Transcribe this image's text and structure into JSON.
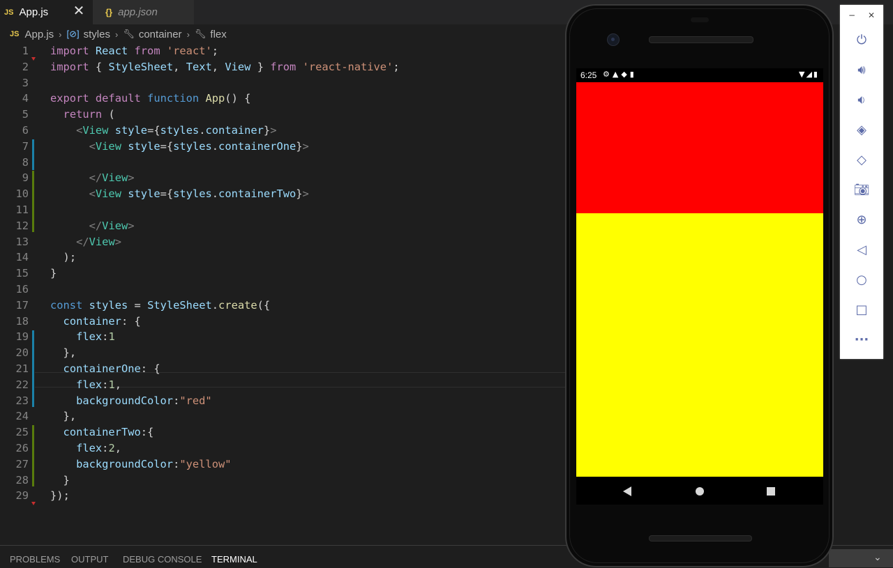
{
  "tabs": [
    {
      "badge": "JS",
      "label": "App.js",
      "close": "✕"
    },
    {
      "badge": "{}",
      "label": "app.json"
    }
  ],
  "breadcrumb": {
    "badge": "JS",
    "items": [
      "App.js",
      "styles",
      "container",
      "flex"
    ]
  },
  "code": {
    "line_numbers": [
      "1",
      "2",
      "3",
      "4",
      "5",
      "6",
      "7",
      "8",
      "9",
      "10",
      "11",
      "12",
      "13",
      "14",
      "15",
      "16",
      "17",
      "18",
      "19",
      "20",
      "21",
      "22",
      "23",
      "24",
      "25",
      "26",
      "27",
      "28",
      "29"
    ],
    "lines": [
      "import React from 'react';",
      "import { StyleSheet, Text, View } from 'react-native';",
      "",
      "export default function App() {",
      "  return (",
      "    <View style={styles.container}>",
      "      <View style={styles.containerOne}>",
      "",
      "      </View>",
      "      <View style={styles.containerTwo}>",
      "",
      "      </View>",
      "    </View>",
      "  );",
      "}",
      "",
      "const styles = StyleSheet.create({",
      "  container: {",
      "    flex:1",
      "  },",
      "  containerOne: {",
      "    flex:1,",
      "    backgroundColor:\"red\"",
      "  },",
      "  containerTwo:{",
      "    flex:2,",
      "    backgroundColor:\"yellow\"",
      "  }",
      "});"
    ]
  },
  "panel": {
    "tabs": [
      "PROBLEMS",
      "OUTPUT",
      "DEBUG CONSOLE",
      "TERMINAL"
    ],
    "active": "TERMINAL"
  },
  "phone": {
    "time": "6:25",
    "container_one_color": "#ff0000",
    "container_two_color": "#ffff00",
    "flex_ratio": [
      1,
      2
    ]
  },
  "emulator_toolbar": {
    "window_controls": [
      "−",
      "✕"
    ],
    "buttons": [
      "power-icon",
      "volume-up-icon",
      "volume-down-icon",
      "rotate-left-icon",
      "rotate-right-icon",
      "camera-icon",
      "zoom-icon",
      "back-icon",
      "home-icon",
      "overview-icon",
      "more-icon"
    ]
  },
  "colors": {
    "editor_bg": "#1e1e1e",
    "keyword": "#c586c0",
    "string": "#ce9178",
    "type": "#4ec9b0",
    "variable": "#9cdcfe",
    "number": "#b5cea8"
  }
}
